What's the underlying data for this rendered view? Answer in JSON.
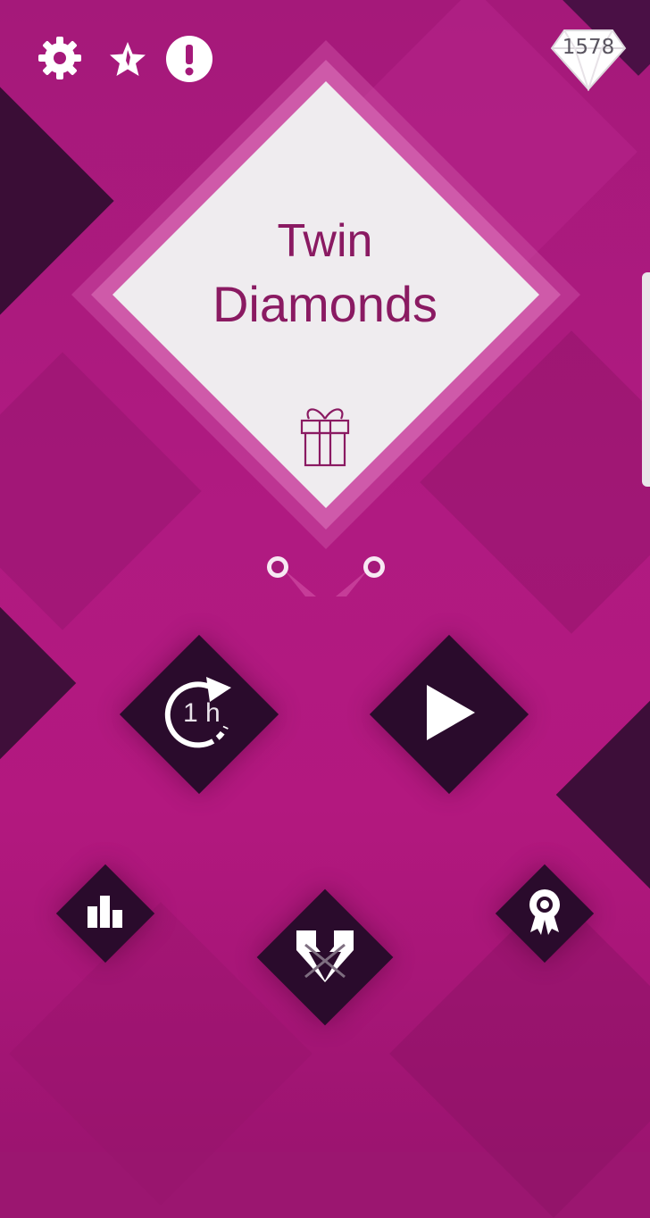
{
  "game": {
    "title_line1": "Twin",
    "title_line2": "Diamonds"
  },
  "gems": {
    "count": "1578"
  },
  "top_bar": {
    "settings_icon": "gear-icon",
    "rate_icon": "star-icon",
    "info_icon": "exclamation-icon"
  },
  "menu": {
    "timer_label": "1 h",
    "timer_icon": "refresh-clock-icon",
    "play_icon": "play-icon",
    "leaderboard_icon": "bar-chart-icon",
    "achievements_icon": "award-ribbon-icon",
    "skins_icon": "twin-diamonds-icon",
    "gift_icon": "gift-icon"
  },
  "colors": {
    "background": "#ad1880",
    "dark_tile": "#2a0b2c",
    "logo_panel": "#efecef",
    "title_text": "#8a1a62",
    "icon_white": "#ffffff"
  }
}
